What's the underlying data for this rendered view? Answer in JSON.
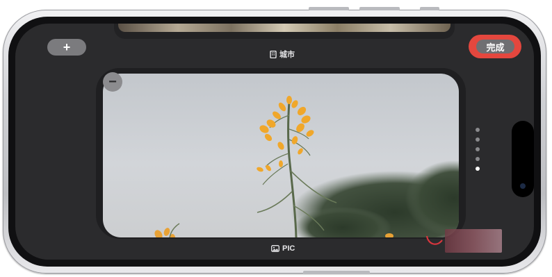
{
  "toolbar": {
    "add_label": "+",
    "done_label": "完成"
  },
  "widgets": {
    "top_widget": {
      "label": "城市",
      "icon": "building-icon"
    },
    "current_widget": {
      "label": "PIC",
      "icon": "photos-icon",
      "remove_label": "−"
    }
  },
  "pagination": {
    "total": 5,
    "active_index": 4
  },
  "colors": {
    "highlight": "#e4473e",
    "screen_bg": "#2b2b2d",
    "button_bg": "#7b7b7e",
    "flower": "#f0a72b",
    "stem": "#58684a"
  }
}
